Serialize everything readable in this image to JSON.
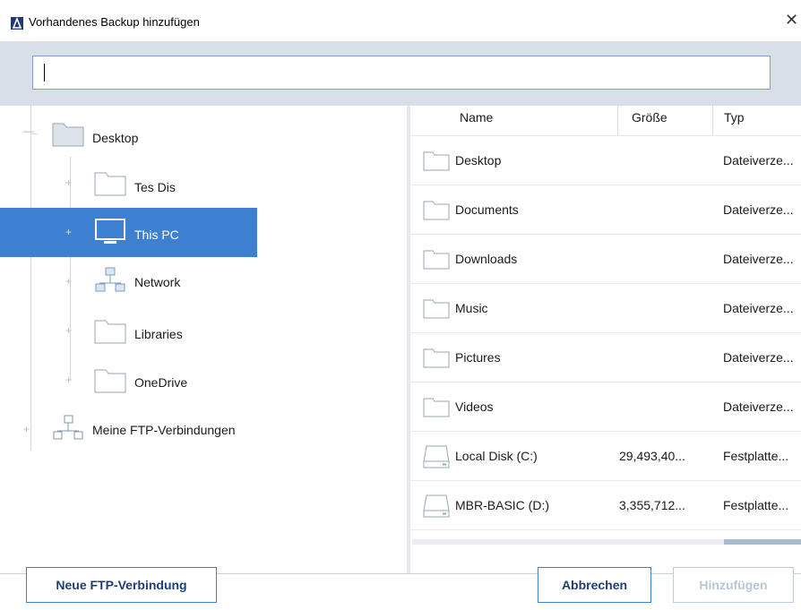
{
  "window": {
    "title": "Vorhandenes Backup hinzufügen"
  },
  "search": {
    "value": "",
    "placeholder": ""
  },
  "tree": {
    "items": [
      {
        "label": "Desktop",
        "icon": "folder-icon"
      },
      {
        "label": "Tes Dis",
        "icon": "folder-icon"
      },
      {
        "label": "This PC",
        "icon": "monitor-icon",
        "selected": true
      },
      {
        "label": "Network",
        "icon": "network-icon"
      },
      {
        "label": "Libraries",
        "icon": "folder-icon"
      },
      {
        "label": "OneDrive",
        "icon": "folder-icon"
      },
      {
        "label": "Meine FTP-Verbindungen",
        "icon": "ftp-connections-icon"
      }
    ]
  },
  "list": {
    "columns": [
      "Name",
      "Größe",
      "Typ"
    ],
    "rows": [
      {
        "name": "Desktop",
        "size": "",
        "type": "Dateiverze...",
        "icon": "folder-icon"
      },
      {
        "name": "Documents",
        "size": "",
        "type": "Dateiverze...",
        "icon": "folder-icon"
      },
      {
        "name": "Downloads",
        "size": "",
        "type": "Dateiverze...",
        "icon": "folder-icon"
      },
      {
        "name": "Music",
        "size": "",
        "type": "Dateiverze...",
        "icon": "folder-icon"
      },
      {
        "name": "Pictures",
        "size": "",
        "type": "Dateiverze...",
        "icon": "folder-icon"
      },
      {
        "name": "Videos",
        "size": "",
        "type": "Dateiverze...",
        "icon": "folder-icon"
      },
      {
        "name": "Local Disk (C:)",
        "size": "29,493,40...",
        "type": "Festplatte...",
        "icon": "hard-disk-icon"
      },
      {
        "name": "MBR-BASIC (D:)",
        "size": "3,355,712...",
        "type": "Festplatte...",
        "icon": "hard-disk-icon"
      }
    ]
  },
  "footer": {
    "new_ftp": "Neue FTP-Verbindung",
    "cancel": "Abbrechen",
    "add": "Hinzufügen"
  },
  "colors": {
    "accent": "#3d7fd1",
    "search_band": "#d7dfe8",
    "disabled": "#b9c6d6"
  }
}
